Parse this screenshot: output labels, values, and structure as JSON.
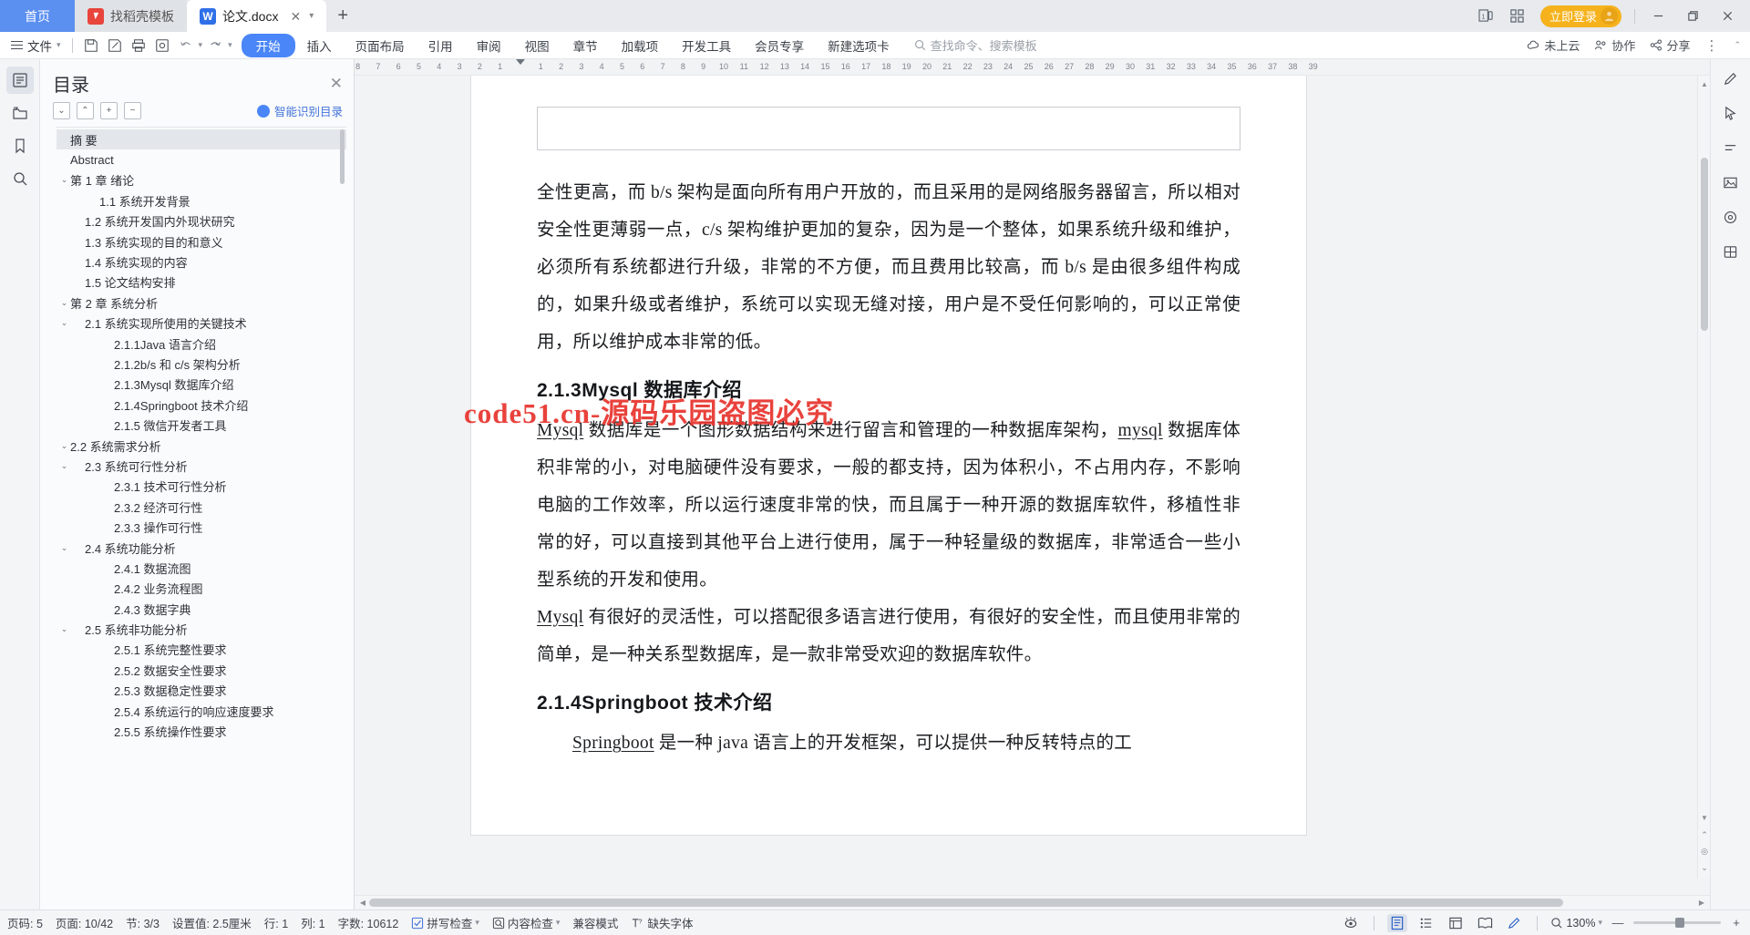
{
  "titlebar": {
    "home_tab": "首页",
    "tabs": [
      {
        "label": "找稻壳模板",
        "icon": "wps-docer-icon",
        "state": "inactive"
      },
      {
        "label": "论文.docx",
        "icon": "wps-writer-icon",
        "state": "active"
      }
    ],
    "new_tab_label": "+",
    "login_label": "立即登录",
    "window_buttons": {
      "minimize": "—",
      "maximize": "❐",
      "close": "✕"
    }
  },
  "ribbon": {
    "file_label": "文件",
    "quick_icons": [
      "save-icon",
      "save-as-icon",
      "print-icon",
      "print-preview-icon",
      "undo-icon",
      "redo-icon",
      "customize-icon"
    ],
    "tabs": [
      {
        "label": "开始",
        "selected": true
      },
      {
        "label": "插入",
        "selected": false
      },
      {
        "label": "页面布局",
        "selected": false
      },
      {
        "label": "引用",
        "selected": false
      },
      {
        "label": "审阅",
        "selected": false
      },
      {
        "label": "视图",
        "selected": false
      },
      {
        "label": "章节",
        "selected": false
      },
      {
        "label": "加载项",
        "selected": false
      },
      {
        "label": "开发工具",
        "selected": false
      },
      {
        "label": "会员专享",
        "selected": false
      },
      {
        "label": "新建选项卡",
        "selected": false
      }
    ],
    "search_placeholder": "查找命令、搜索模板",
    "right_items": [
      {
        "label": "未上云",
        "icon": "cloud-icon"
      },
      {
        "label": "协作",
        "icon": "collaborate-icon"
      },
      {
        "label": "分享",
        "icon": "share-icon"
      }
    ]
  },
  "left_rail": [
    {
      "name": "outline-icon",
      "active": true
    },
    {
      "name": "folder-icon",
      "active": false
    },
    {
      "name": "bookmark-icon",
      "active": false
    },
    {
      "name": "search-icon",
      "active": false
    }
  ],
  "toc": {
    "title": "目录",
    "close_label": "✕",
    "tools": [
      "collapse-down",
      "collapse-up",
      "expand-all",
      "collapse-all"
    ],
    "smart_label": "智能识别目录",
    "items": [
      {
        "label": "摘  要",
        "indent": 0,
        "chevron": "",
        "selected": true
      },
      {
        "label": "Abstract",
        "indent": 0,
        "chevron": "",
        "selected": false
      },
      {
        "label": "第 1 章  绪论",
        "indent": 0,
        "chevron": "v",
        "selected": false
      },
      {
        "label": "1.1 系统开发背景",
        "indent": 2,
        "chevron": "",
        "selected": false
      },
      {
        "label": "1.2 系统开发国内外现状研究",
        "indent": 1,
        "chevron": "",
        "selected": false
      },
      {
        "label": "1.3 系统实现的目的和意义",
        "indent": 1,
        "chevron": "",
        "selected": false
      },
      {
        "label": "1.4 系统实现的内容",
        "indent": 1,
        "chevron": "",
        "selected": false
      },
      {
        "label": "1.5 论文结构安排",
        "indent": 1,
        "chevron": "",
        "selected": false
      },
      {
        "label": "第 2 章  系统分析",
        "indent": 0,
        "chevron": "v",
        "selected": false
      },
      {
        "label": "2.1 系统实现所使用的关键技术",
        "indent": 1,
        "chevron": "v",
        "selected": false
      },
      {
        "label": "2.1.1Java 语言介绍",
        "indent": 3,
        "chevron": "",
        "selected": false
      },
      {
        "label": "2.1.2b/s 和 c/s 架构分析",
        "indent": 3,
        "chevron": "",
        "selected": false
      },
      {
        "label": "2.1.3Mysql 数据库介绍",
        "indent": 3,
        "chevron": "",
        "selected": false
      },
      {
        "label": "2.1.4Springboot 技术介绍",
        "indent": 3,
        "chevron": "",
        "selected": false
      },
      {
        "label": "2.1.5 微信开发者工具",
        "indent": 3,
        "chevron": "",
        "selected": false
      },
      {
        "label": "2.2 系统需求分析",
        "indent": 0,
        "chevron": "v",
        "selected": false
      },
      {
        "label": "2.3 系统可行性分析",
        "indent": 1,
        "chevron": "v",
        "selected": false
      },
      {
        "label": "2.3.1 技术可行性分析",
        "indent": 3,
        "chevron": "",
        "selected": false
      },
      {
        "label": "2.3.2 经济可行性",
        "indent": 3,
        "chevron": "",
        "selected": false
      },
      {
        "label": "2.3.3 操作可行性",
        "indent": 3,
        "chevron": "",
        "selected": false
      },
      {
        "label": "2.4 系统功能分析",
        "indent": 1,
        "chevron": "v",
        "selected": false
      },
      {
        "label": "2.4.1 数据流图",
        "indent": 3,
        "chevron": "",
        "selected": false
      },
      {
        "label": "2.4.2  业务流程图",
        "indent": 3,
        "chevron": "",
        "selected": false
      },
      {
        "label": "2.4.3 数据字典",
        "indent": 3,
        "chevron": "",
        "selected": false
      },
      {
        "label": "2.5  系统非功能分析",
        "indent": 1,
        "chevron": "v",
        "selected": false
      },
      {
        "label": "2.5.1 系统完整性要求",
        "indent": 3,
        "chevron": "",
        "selected": false
      },
      {
        "label": "2.5.2 数据安全性要求",
        "indent": 3,
        "chevron": "",
        "selected": false
      },
      {
        "label": "2.5.3 数据稳定性要求",
        "indent": 3,
        "chevron": "",
        "selected": false
      },
      {
        "label": "2.5.4 系统运行的响应速度要求",
        "indent": 3,
        "chevron": "",
        "selected": false
      },
      {
        "label": "2.5.5 系统操作性要求",
        "indent": 3,
        "chevron": "",
        "selected": false
      }
    ]
  },
  "ruler": {
    "left_ticks": [
      "8",
      "7",
      "6",
      "5",
      "4",
      "3",
      "2",
      "1"
    ],
    "right_ticks": [
      "1",
      "2",
      "3",
      "4",
      "5",
      "6",
      "7",
      "8",
      "9",
      "10",
      "11",
      "12",
      "13",
      "14",
      "15",
      "16",
      "17",
      "18",
      "19",
      "20",
      "21",
      "22",
      "23",
      "24",
      "25",
      "26",
      "27",
      "28",
      "29",
      "30",
      "31",
      "32",
      "33",
      "34",
      "35",
      "36",
      "37",
      "38",
      "39"
    ]
  },
  "document": {
    "paragraph_1": "全性更高，而 b/s 架构是面向所有用户开放的，而且采用的是网络服务器留言，所以相对安全性更薄弱一点，c/s 架构维护更加的复杂，因为是一个整体，如果系统升级和维护，必须所有系统都进行升级，非常的不方便，而且费用比较高，而 b/s 是由很多组件构成的，如果升级或者维护，系统可以实现无缝对接，用户是不受任何影响的，可以正常使用，所以维护成本非常的低。",
    "heading_1": "2.1.3Mysql 数据库介绍",
    "para2_a": "Mysql",
    "para2_b": " 数据库是一个图形数据结构来进行留言和管理的一种数据库架构，",
    "para2_c": "mysql",
    "para2_d": " 数据库体积非常的小，对电脑硬件没有要求，一般的都支持，因为体积小，不占用内存，不影响电脑的工作效率，所以运行速度非常的快，而且属于一种开源的数据库软件，移植性非常的好，可以直接到其他平台上进行使用，属于一种轻量级的数据库，非常适合一些小型系统的开发和使用。",
    "para3_a": "Mysql",
    "para3_b": " 有很好的灵活性，可以搭配很多语言进行使用，有很好的安全性，而且使用非常的简单，是一种关系型数据库，是一款非常受欢迎的数据库软件。",
    "heading_2": "2.1.4Springboot 技术介绍",
    "para4_a": "Springboot",
    "para4_b": " 是一种 java 语言上的开发框架，可以提供一种反转特点的工",
    "watermark": "code51.cn-源码乐园盗图必究"
  },
  "right_rail": [
    {
      "name": "pen-icon"
    },
    {
      "name": "cursor-icon"
    },
    {
      "name": "format-icon"
    },
    {
      "name": "image-icon"
    },
    {
      "name": "shape-icon"
    },
    {
      "name": "chart-icon"
    }
  ],
  "status": {
    "page_number": "页码: 5",
    "page_count": "页面: 10/42",
    "section": "节: 3/3",
    "setting": "设置值: 2.5厘米",
    "row": "行: 1",
    "col": "列: 1",
    "word_count": "字数: 10612",
    "spellcheck": "拼写检查",
    "content_check": "内容检查",
    "compat_mode": "兼容模式",
    "missing_font": "缺失字体",
    "zoom_level": "130%",
    "zoom_minus": "—",
    "zoom_plus": "+",
    "view_modes": [
      "page-view",
      "outline-view",
      "web-view",
      "read-view",
      "edit-mode",
      "eye-icon"
    ]
  }
}
